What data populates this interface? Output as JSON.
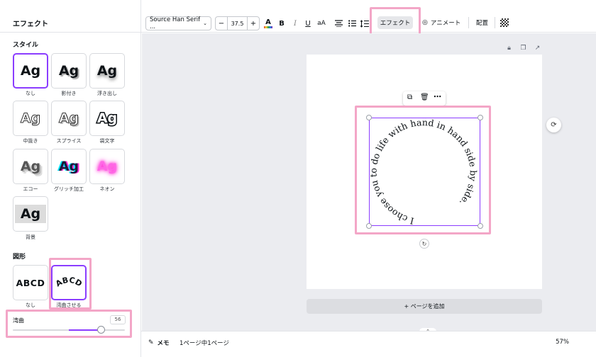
{
  "panel": {
    "title": "エフェクト",
    "style_section": "スタイル",
    "styles": [
      {
        "sample": "Ag",
        "label": "なし"
      },
      {
        "sample": "Ag",
        "label": "影付き"
      },
      {
        "sample": "Ag",
        "label": "浮き出し"
      },
      {
        "sample": "Ag",
        "label": "中抜き"
      },
      {
        "sample": "Ag",
        "label": "スプライス"
      },
      {
        "sample": "Ag",
        "label": "袋文字"
      },
      {
        "sample": "Ag",
        "label": "エコー"
      },
      {
        "sample": "Ag",
        "label": "グリッチ加工"
      },
      {
        "sample": "Ag",
        "label": "ネオン"
      },
      {
        "sample": "Ag",
        "label": "背景"
      }
    ],
    "shape_section": "図形",
    "shapes": [
      {
        "sample": "ABCD",
        "label": "なし"
      },
      {
        "sample": "ABCD",
        "label": "湾曲させる"
      }
    ],
    "curve": {
      "label": "湾曲",
      "value": "56"
    }
  },
  "toolbar": {
    "font": "Source Han Serif ...",
    "size_minus": "−",
    "size": "37.5",
    "size_plus": "+",
    "bold": "B",
    "italic": "I",
    "underline": "U",
    "case": "aA",
    "effect": "エフェクト",
    "animate": "アニメート",
    "arrange": "配置"
  },
  "canvas": {
    "curved_text": "I choose you to do life with hand in hand side by side.",
    "add_page": "+ ページを追加"
  },
  "footer": {
    "memo": "メモ",
    "page_count": "1ページ中1ページ",
    "zoom": "57%"
  },
  "colors": {
    "accent": "#8b3dff",
    "highlight": "#f3a6c7"
  }
}
